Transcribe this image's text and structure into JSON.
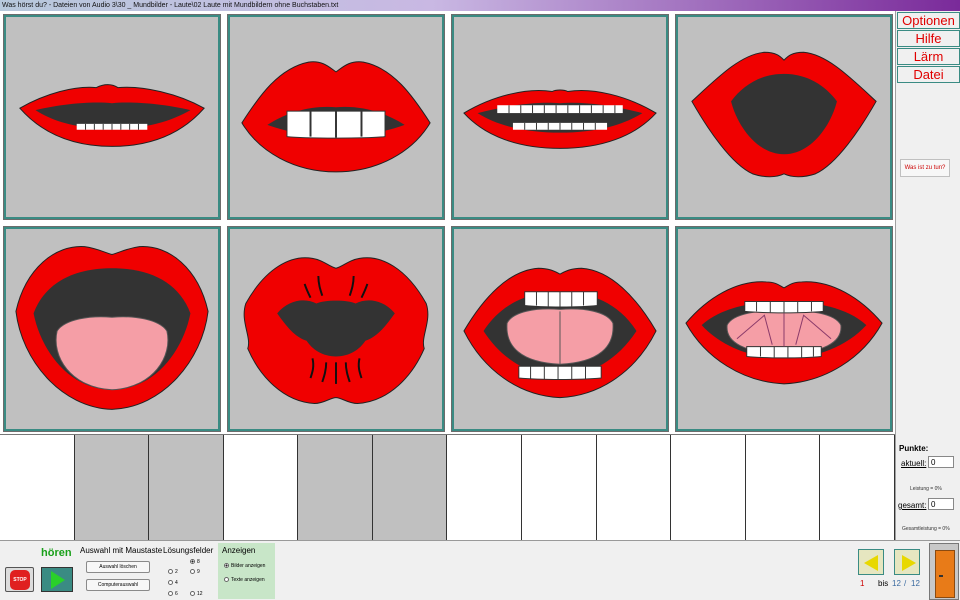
{
  "window": {
    "title": "Was hörst du? - Dateien von Audio 3\\30 _ Mundbilder - Laute\\02 Laute mit Mundbildern ohne Buchstaben.txt"
  },
  "mouths": [
    {
      "name": "mouth-wide-smile"
    },
    {
      "name": "mouth-open-teeth"
    },
    {
      "name": "mouth-wide-teeth"
    },
    {
      "name": "mouth-round-o"
    },
    {
      "name": "mouth-tongue-out"
    },
    {
      "name": "mouth-pursed"
    },
    {
      "name": "mouth-open-tongue"
    },
    {
      "name": "mouth-open-tongue-teeth"
    }
  ],
  "menu": {
    "optionen": "Optionen",
    "hilfe": "Hilfe",
    "laerm": "Lärm",
    "datei": "Datei",
    "help_question": "Was ist zu tun?"
  },
  "slots": [
    "white",
    "gray",
    "gray",
    "white",
    "gray",
    "gray",
    "white",
    "white",
    "white",
    "white",
    "white",
    "white"
  ],
  "score": {
    "title": "Punkte:",
    "aktuell_label": "aktuell:",
    "aktuell_value": "0",
    "leistung": "Leistung = 0%",
    "gesamt_label": "gesamt:",
    "gesamt_value": "0",
    "gesamtleistung": "Gesamtleistung = 0%"
  },
  "bottom": {
    "hoeren": "hören",
    "stop": "STOP",
    "auswahl_title": "Auswahl mit Maustaste",
    "auswahl_loeschen": "Auswahl löschen",
    "computerauswahl": "Computerauswahl",
    "loesungsfelder_title": "Lösungsfelder",
    "loesungsfelder_options": [
      "8",
      "2",
      "9",
      "4",
      "6",
      "12"
    ],
    "anzeigen_title": "Anzeigen",
    "bilder_anzeigen": "Bilder anzeigen",
    "texte_anzeigen": "Texte anzeigen",
    "page_from": "1",
    "bis": "bis",
    "page_to": "12",
    "slash": "/",
    "page_total": "12"
  },
  "colors": {
    "lips": "#f00000",
    "mouth_dark": "#333333",
    "tongue": "#f59ea6",
    "tile_bg": "#c0c0c0",
    "tile_border": "#3a8b83",
    "menu_text": "#e00000"
  }
}
